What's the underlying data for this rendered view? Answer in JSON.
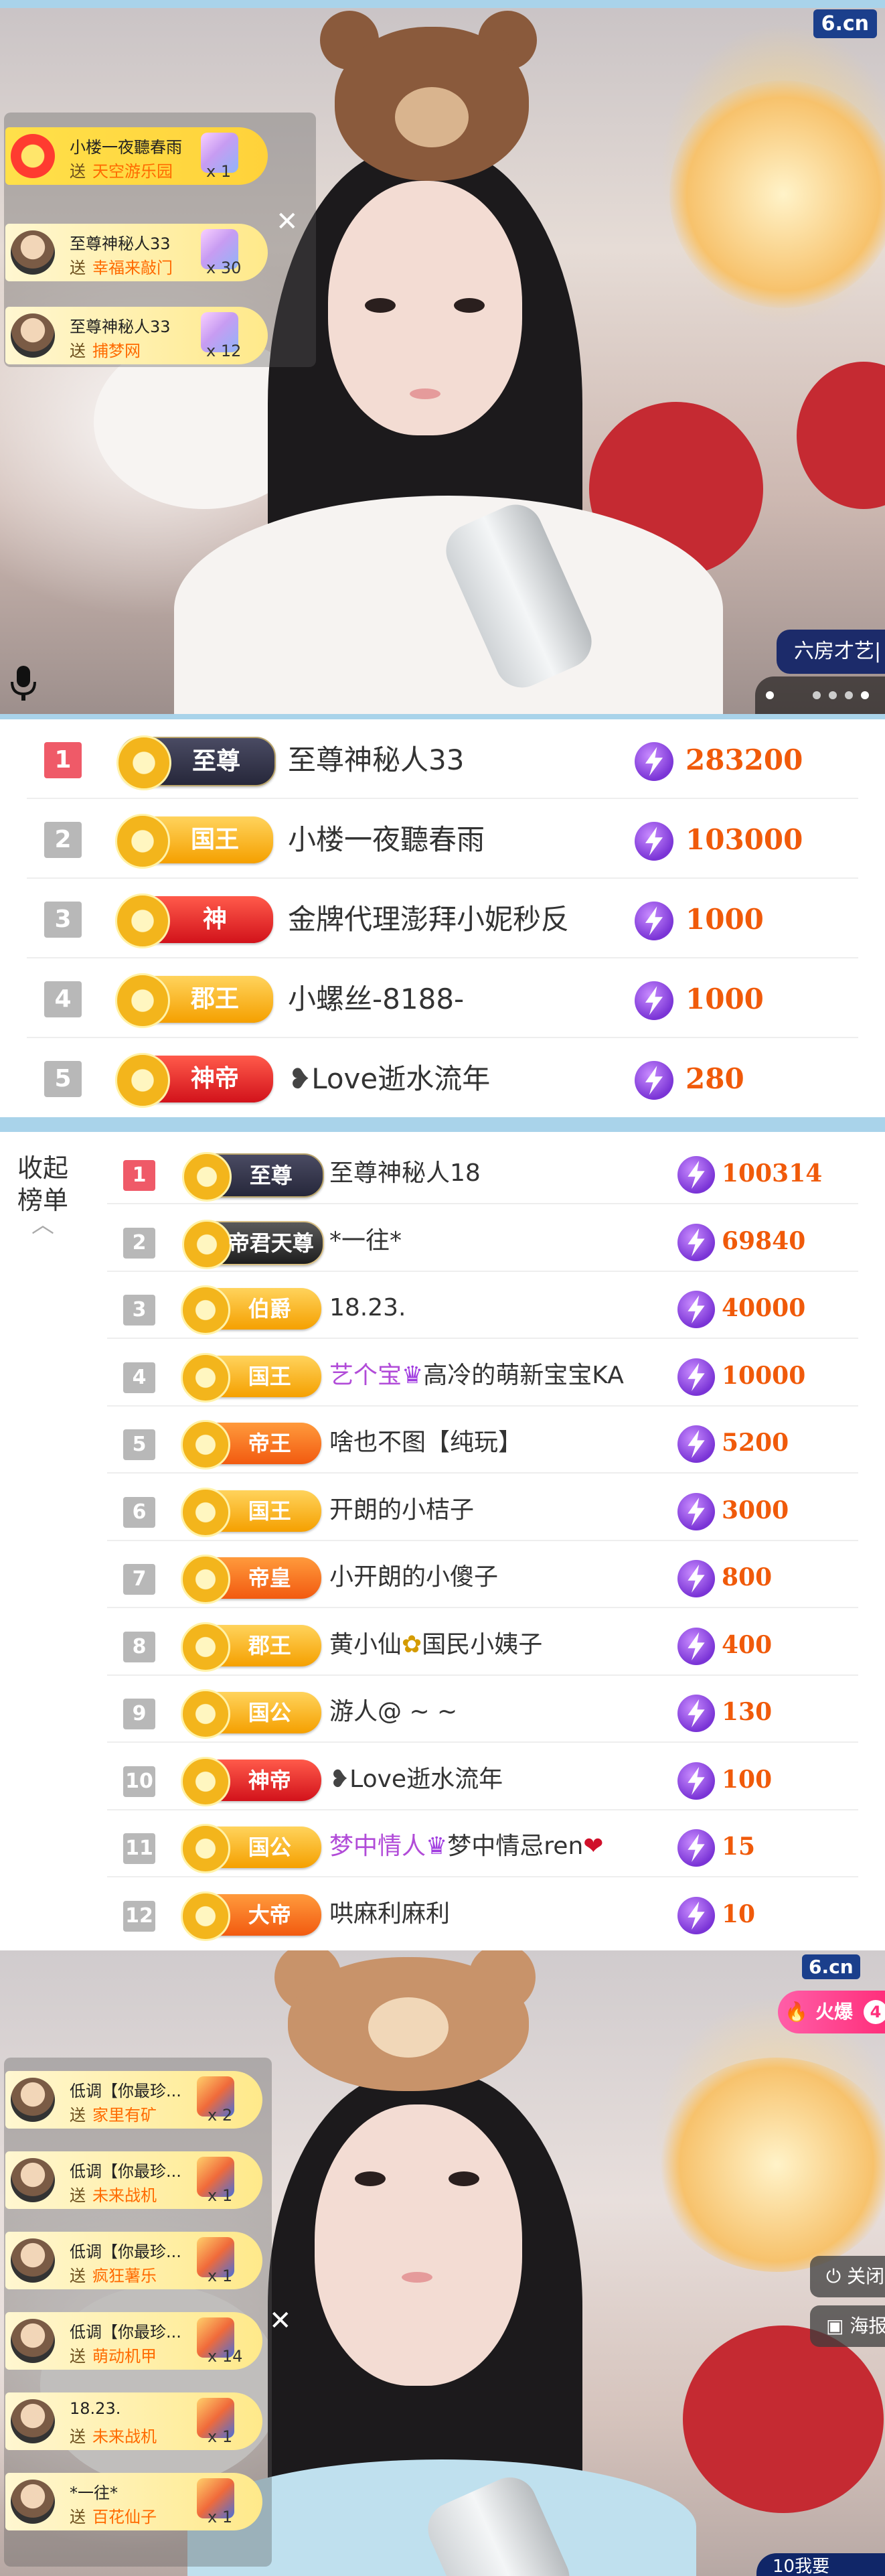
{
  "top_video": {
    "logo": "6.cn",
    "room_label": "六房才艺|",
    "mic_icon": "mic-icon",
    "gifts": [
      {
        "name": "小楼一夜聽春雨",
        "verb": "送",
        "item": "天空游乐园",
        "count": "x 1"
      },
      {
        "name": "至尊神秘人33",
        "verb": "送",
        "item": "幸福来敲门",
        "count": "x 30"
      },
      {
        "name": "至尊神秘人33",
        "verb": "送",
        "item": "捕梦网",
        "count": "x 12"
      }
    ]
  },
  "rank_top5": [
    {
      "rank": "1",
      "badge": "至尊",
      "name": "至尊神秘人33",
      "score": "283200"
    },
    {
      "rank": "2",
      "badge": "国王",
      "name": "小楼一夜聽春雨",
      "score": "103000"
    },
    {
      "rank": "3",
      "badge": "神",
      "name": "金牌代理澎拜小妮秒反",
      "score": "1000"
    },
    {
      "rank": "4",
      "badge": "郡王",
      "name": "小螺丝-8188-",
      "score": "1000"
    },
    {
      "rank": "5",
      "badge": "神帝",
      "name": "Love逝水流年",
      "score": "280"
    }
  ],
  "rank_full": {
    "collapse_label": [
      "收起",
      "榜单"
    ],
    "rows": [
      {
        "rank": "1",
        "badge": "至尊",
        "name": "至尊神秘人18",
        "score": "100314"
      },
      {
        "rank": "2",
        "badge": "帝君天尊",
        "name": "*一往*",
        "score": "69840"
      },
      {
        "rank": "3",
        "badge": "伯爵",
        "name": "18.23.",
        "score": "40000"
      },
      {
        "rank": "4",
        "badge": "国王",
        "name_prefix": "艺个宝",
        "name": "高冷的萌新宝宝KA",
        "score": "10000"
      },
      {
        "rank": "5",
        "badge": "帝王",
        "name": "啥也不图【纯玩】",
        "score": "5200"
      },
      {
        "rank": "6",
        "badge": "国王",
        "name": "开朗的小桔子",
        "score": "3000"
      },
      {
        "rank": "7",
        "badge": "帝皇",
        "name": "小开朗的小傻子",
        "score": "800"
      },
      {
        "rank": "8",
        "badge": "郡王",
        "name": "黄小仙",
        "name_suffix": "国民小姨子",
        "score": "400"
      },
      {
        "rank": "9",
        "badge": "国公",
        "name": "游人@ ~ ~",
        "score": "130"
      },
      {
        "rank": "10",
        "badge": "神帝",
        "name": "Love逝水流年",
        "score": "100"
      },
      {
        "rank": "11",
        "badge": "国公",
        "name_prefix": "梦中情人",
        "name": "梦中情忌ren",
        "score": "15"
      },
      {
        "rank": "12",
        "badge": "大帝",
        "name": "哄麻利麻利",
        "score": "10"
      }
    ]
  },
  "bottom_video": {
    "logo": "6.cn",
    "hot_label": "火爆",
    "hot_count": "4",
    "close_label": "关闭",
    "poster_label": "海报",
    "bottom_label": "10我要",
    "gifts": [
      {
        "name": "低调【你最珍...",
        "verb": "送",
        "item": "家里有矿",
        "count": "x 2"
      },
      {
        "name": "低调【你最珍...",
        "verb": "送",
        "item": "未来战机",
        "count": "x 1"
      },
      {
        "name": "低调【你最珍...",
        "verb": "送",
        "item": "疯狂薯乐",
        "count": "x 1"
      },
      {
        "name": "低调【你最珍...",
        "verb": "送",
        "item": "萌动机甲",
        "count": "x 14"
      },
      {
        "name": "18.23.",
        "verb": "送",
        "item": "未来战机",
        "count": "x 1"
      },
      {
        "name": "*一往*",
        "verb": "送",
        "item": "百花仙子",
        "count": "x 1"
      }
    ]
  },
  "colors": {
    "rank_first": "#ef5a68",
    "score": "#f05a0a",
    "flash": "#7a34d6",
    "video_frame": "#a9d3ea"
  }
}
